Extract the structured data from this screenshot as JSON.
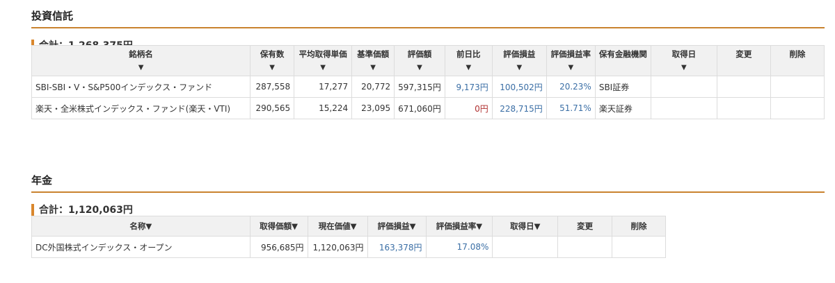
{
  "investment_trust": {
    "title": "投資信託",
    "total": "合計：1,268,375円",
    "headers": [
      "銘柄名",
      "保有数",
      "平均取得単価",
      "基準価額",
      "評価額",
      "前日比",
      "評価損益",
      "評価損益率",
      "保有金融機関",
      "取得日",
      "変更",
      "削除"
    ],
    "sort_arrow": "▼",
    "rows": [
      {
        "name": "SBI-SBI・V・S&P500インデックス・ファンド",
        "holdings": "287,558",
        "avg_cost": "17,277",
        "base_price": "20,772",
        "valuation": "597,315円",
        "day_change": "9,173円",
        "profit": "100,502円",
        "profit_rate": "20.23%",
        "institution": "SBI証券",
        "acquired": "",
        "edit": "",
        "delete": ""
      },
      {
        "name": "楽天・全米株式インデックス・ファンド(楽天・VTI)",
        "holdings": "290,565",
        "avg_cost": "15,224",
        "base_price": "23,095",
        "valuation": "671,060円",
        "day_change": "0円",
        "profit": "228,715円",
        "profit_rate": "51.71%",
        "institution": "楽天証券",
        "acquired": "",
        "edit": "",
        "delete": ""
      }
    ]
  },
  "pension": {
    "title": "年金",
    "total": "合計：1,120,063円",
    "headers": [
      "名称▼",
      "取得価額▼",
      "現在価値▼",
      "評価損益▼",
      "評価損益率▼",
      "取得日▼",
      "変更",
      "削除"
    ],
    "rows": [
      {
        "name": "DC外国株式インデックス・オープン",
        "acq_value": "956,685円",
        "current_value": "1,120,063円",
        "profit": "163,378円",
        "profit_rate": "17.08%",
        "acquired": "",
        "edit": "",
        "delete": ""
      }
    ]
  },
  "colors": {
    "accent": "#c9822e",
    "positive": "#3a6ea5",
    "zero": "#b03030"
  }
}
